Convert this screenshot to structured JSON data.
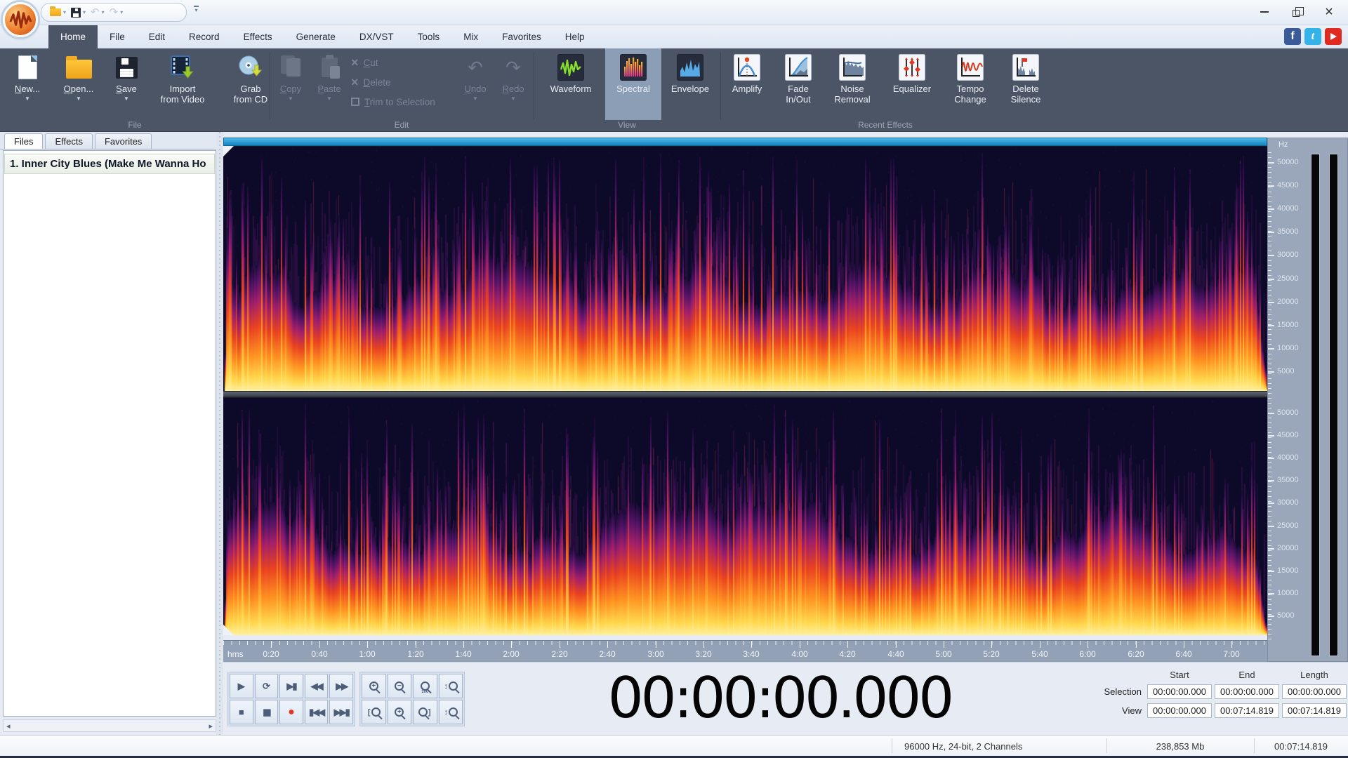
{
  "titlebar": {
    "quick_access_icons": [
      "folder-icon",
      "save-icon",
      "undo-icon",
      "redo-icon",
      "customize-arrow-icon"
    ],
    "window_controls": {
      "minimize": "minimize",
      "maximize": "restore",
      "close": "close"
    }
  },
  "menu": {
    "tabs": [
      "Home",
      "File",
      "Edit",
      "Record",
      "Effects",
      "Generate",
      "DX/VST",
      "Tools",
      "Mix",
      "Favorites",
      "Help"
    ],
    "active_index": 0,
    "social_icons": [
      "facebook-icon",
      "twitter-icon",
      "youtube-icon"
    ]
  },
  "ribbon": {
    "group_labels": {
      "file": "File",
      "edit": "Edit",
      "view": "View",
      "recent_effects": "Recent Effects"
    },
    "buttons": {
      "new": "New...",
      "open": "Open...",
      "save": "Save",
      "import_video": "Import from Video",
      "grab_cd": "Grab from CD",
      "copy": "Copy",
      "paste": "Paste",
      "cut": "Cut",
      "delete": "Delete",
      "trim": "Trim to Selection",
      "undo": "Undo",
      "redo": "Redo",
      "waveform": "Waveform",
      "spectral": "Spectral",
      "envelope": "Envelope",
      "active_view": "Spectral"
    },
    "effects": [
      {
        "name": "amplify",
        "label": "Amplify"
      },
      {
        "name": "fade-in-out",
        "label": "Fade In/Out"
      },
      {
        "name": "noise-removal",
        "label": "Noise Removal"
      },
      {
        "name": "equalizer",
        "label": "Equalizer"
      },
      {
        "name": "tempo-change",
        "label": "Tempo Change"
      },
      {
        "name": "delete-silence",
        "label": "Delete Silence"
      }
    ]
  },
  "sidebar": {
    "tabs": [
      "Files",
      "Effects",
      "Favorites"
    ],
    "active_tab": "Files",
    "files": [
      "1. Inner City Blues (Make Me Wanna Ho"
    ]
  },
  "spectrogram": {
    "unit": "Hz",
    "freq_ticks": [
      "50000",
      "45000",
      "40000",
      "35000",
      "30000",
      "25000",
      "20000",
      "15000",
      "10000",
      "5000"
    ],
    "channel_count": 2
  },
  "ruler": {
    "unit": "hms",
    "ticks": [
      "0:20",
      "0:40",
      "1:00",
      "1:20",
      "1:40",
      "2:00",
      "2:20",
      "2:40",
      "3:00",
      "3:20",
      "3:40",
      "4:00",
      "4:20",
      "4:40",
      "5:00",
      "5:20",
      "5:40",
      "6:00",
      "6:20",
      "6:40",
      "7:00"
    ]
  },
  "transport": {
    "row1": [
      {
        "name": "play-icon",
        "glyph": "▶"
      },
      {
        "name": "loop-icon",
        "glyph": "⟳"
      },
      {
        "name": "play-to-end-icon",
        "glyph": "▶▮"
      },
      {
        "name": "rewind-icon",
        "glyph": "◀◀"
      },
      {
        "name": "fast-forward-icon",
        "glyph": "▶▶"
      }
    ],
    "row2": [
      {
        "name": "stop-icon",
        "glyph": "■"
      },
      {
        "name": "pause-icon",
        "glyph": "▮▮"
      },
      {
        "name": "record-icon",
        "glyph": "●",
        "color": "#e53422"
      },
      {
        "name": "go-to-start-icon",
        "glyph": "▮◀◀"
      },
      {
        "name": "go-to-end-icon",
        "glyph": "▶▶▮"
      }
    ]
  },
  "zoom_tools": {
    "row1": [
      {
        "name": "zoom-in-icon",
        "inner": "+"
      },
      {
        "name": "zoom-out-icon",
        "inner": "−"
      },
      {
        "name": "zoom-100-icon",
        "sub": "100"
      },
      {
        "name": "zoom-vertical-in-icon",
        "pre": "↕"
      }
    ],
    "row2": [
      {
        "name": "zoom-selection-start-icon",
        "pre": "["
      },
      {
        "name": "zoom-full-icon",
        "inner": "+"
      },
      {
        "name": "zoom-selection-end-icon",
        "post": "]"
      },
      {
        "name": "zoom-vertical-out-icon",
        "pre": "↕"
      }
    ]
  },
  "time_display": "00:00:00.000",
  "selection_panel": {
    "col_headers": [
      "Start",
      "End",
      "Length"
    ],
    "rows": [
      {
        "label": "Selection",
        "values": [
          "00:00:00.000",
          "00:00:00.000",
          "00:00:00.000"
        ]
      },
      {
        "label": "View",
        "values": [
          "00:00:00.000",
          "00:07:14.819",
          "00:07:14.819"
        ]
      }
    ]
  },
  "status_bar": {
    "format": "96000 Hz, 24-bit, 2 Channels",
    "file_size": "238,853 Mb",
    "duration": "00:07:14.819"
  }
}
